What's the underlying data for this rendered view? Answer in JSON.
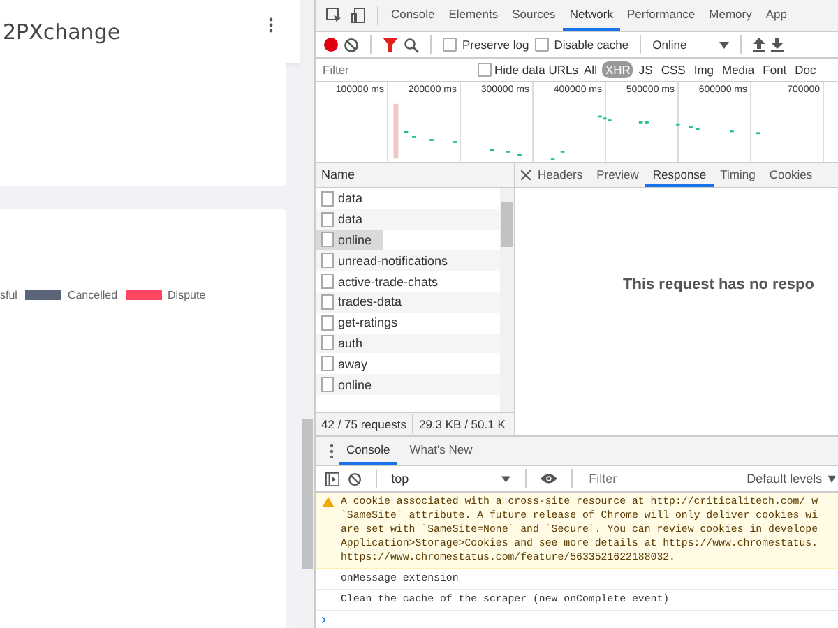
{
  "app": {
    "title": "2PXchange",
    "legend": [
      {
        "label": "sful"
      },
      {
        "label": "Cancelled",
        "color": "#5b6579"
      },
      {
        "label": "Dispute",
        "color": "#ff4560"
      }
    ]
  },
  "devtools": {
    "tabs": [
      {
        "label": "Console",
        "selected": false
      },
      {
        "label": "Elements",
        "selected": false
      },
      {
        "label": "Sources",
        "selected": false
      },
      {
        "label": "Network",
        "selected": true
      },
      {
        "label": "Performance",
        "selected": false
      },
      {
        "label": "Memory",
        "selected": false
      },
      {
        "label": "App",
        "selected": false
      }
    ],
    "toolbar": {
      "recording": true,
      "preserve_log": {
        "label": "Preserve log",
        "checked": false
      },
      "disable_cache": {
        "label": "Disable cache",
        "checked": false
      },
      "throttle": "Online"
    },
    "filter": {
      "placeholder": "Filter",
      "hide_data_urls": {
        "label": "Hide data URLs",
        "checked": false
      },
      "types": [
        {
          "label": "All",
          "selected": false
        },
        {
          "label": "XHR",
          "selected": true
        },
        {
          "label": "JS",
          "selected": false
        },
        {
          "label": "CSS",
          "selected": false
        },
        {
          "label": "Img",
          "selected": false
        },
        {
          "label": "Media",
          "selected": false
        },
        {
          "label": "Font",
          "selected": false
        },
        {
          "label": "Doc",
          "selected": false
        }
      ]
    },
    "timeline_ticks": [
      "100000 ms",
      "200000 ms",
      "300000 ms",
      "400000 ms",
      "500000 ms",
      "600000 ms",
      "700000"
    ],
    "name_header": "Name",
    "requests": [
      {
        "name": "data",
        "selected": false
      },
      {
        "name": "data",
        "selected": false
      },
      {
        "name": "online",
        "selected": true
      },
      {
        "name": "unread-notifications",
        "selected": false
      },
      {
        "name": "active-trade-chats",
        "selected": false
      },
      {
        "name": "trades-data",
        "selected": false
      },
      {
        "name": "get-ratings",
        "selected": false
      },
      {
        "name": "auth",
        "selected": false
      },
      {
        "name": "away",
        "selected": false
      },
      {
        "name": "online",
        "selected": false
      }
    ],
    "summary": [
      "42 / 75 requests",
      "29.3 KB / 50.1 K"
    ],
    "detail_tabs": [
      {
        "label": "Headers",
        "selected": false
      },
      {
        "label": "Preview",
        "selected": false
      },
      {
        "label": "Response",
        "selected": true
      },
      {
        "label": "Timing",
        "selected": false
      },
      {
        "label": "Cookies",
        "selected": false
      }
    ],
    "detail_message": "This request has no respo",
    "drawer_tabs": [
      {
        "label": "Console",
        "selected": true
      },
      {
        "label": "What's New",
        "selected": false
      }
    ],
    "console_toolbar": {
      "context": "top",
      "filter_placeholder": "Filter",
      "levels": "Default levels ▼"
    },
    "messages": [
      {
        "kind": "warning",
        "lines": [
          "A cookie associated with a cross-site resource at http://criticalitech.com/ w",
          "`SameSite` attribute. A future release of Chrome will only deliver cookies wi",
          "are set with `SameSite=None` and `Secure`. You can review cookies in develope",
          "Application>Storage>Cookies and see more details at https://www.chromestatus.",
          "https://www.chromestatus.com/feature/5633521622188032."
        ]
      },
      {
        "kind": "log",
        "lines": [
          "onMessage extension"
        ]
      },
      {
        "kind": "log",
        "lines": [
          "Clean the cache of the scraper (new onComplete event)"
        ]
      }
    ],
    "prompt": "›"
  }
}
